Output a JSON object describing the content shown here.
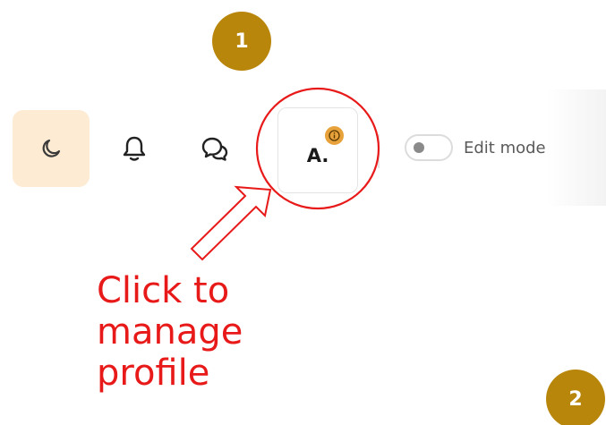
{
  "steps": {
    "first": "1",
    "second": "2"
  },
  "toolbar": {
    "theme_icon": "moon-icon",
    "notifications_icon": "bell-icon",
    "messages_icon": "chat-bubbles-icon",
    "profile": {
      "initial": "A.",
      "badge_icon": "info-icon"
    },
    "edit_mode": {
      "label": "Edit mode",
      "enabled": false
    }
  },
  "annotation": {
    "callout": "Click to\nmanage\nprofile",
    "color": "#e81919"
  },
  "colors": {
    "step_badge": "#b8860b",
    "theme_button_bg": "#fdebd3",
    "profile_badge": "#e8a23b"
  }
}
